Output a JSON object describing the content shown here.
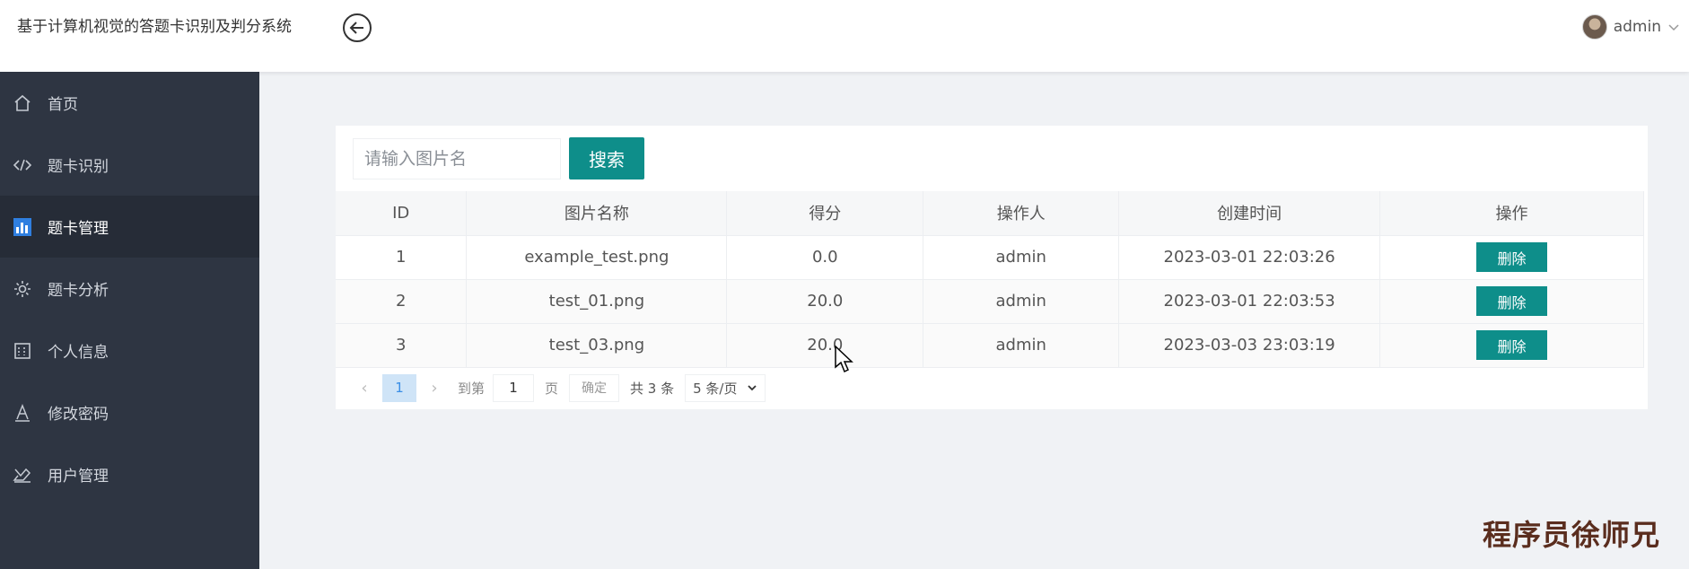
{
  "header": {
    "title": "基于计算机视觉的答题卡识别及判分系统",
    "user_name": "admin"
  },
  "sidebar": {
    "items": [
      {
        "label": "首页",
        "icon": "home-icon"
      },
      {
        "label": "题卡识别",
        "icon": "code-icon"
      },
      {
        "label": "题卡管理",
        "icon": "chart-icon",
        "active": true
      },
      {
        "label": "题卡分析",
        "icon": "gear-icon"
      },
      {
        "label": "个人信息",
        "icon": "id-card-icon"
      },
      {
        "label": "修改密码",
        "icon": "font-icon"
      },
      {
        "label": "用户管理",
        "icon": "user-manage-icon"
      }
    ]
  },
  "search": {
    "placeholder": "请输入图片名",
    "button_label": "搜索"
  },
  "table": {
    "columns": [
      "ID",
      "图片名称",
      "得分",
      "操作人",
      "创建时间",
      "操作"
    ],
    "rows": [
      {
        "id": "1",
        "name": "example_test.png",
        "score": "0.0",
        "operator": "admin",
        "created": "2023-03-01 22:03:26",
        "action": "删除"
      },
      {
        "id": "2",
        "name": "test_01.png",
        "score": "20.0",
        "operator": "admin",
        "created": "2023-03-01 22:03:53",
        "action": "删除"
      },
      {
        "id": "3",
        "name": "test_03.png",
        "score": "20.0",
        "operator": "admin",
        "created": "2023-03-03 23:03:19",
        "action": "删除"
      }
    ]
  },
  "pagination": {
    "current_page": "1",
    "goto_label": "到第",
    "goto_value": "1",
    "page_label": "页",
    "confirm_label": "确定",
    "total_label": "共 3 条",
    "page_size_label": "5 条/页"
  },
  "watermark": "程序员徐师兄",
  "colors": {
    "sidebar_bg": "#2e3542",
    "accent_teal": "#0e8e8a",
    "page_active": "#3a8ee6"
  }
}
